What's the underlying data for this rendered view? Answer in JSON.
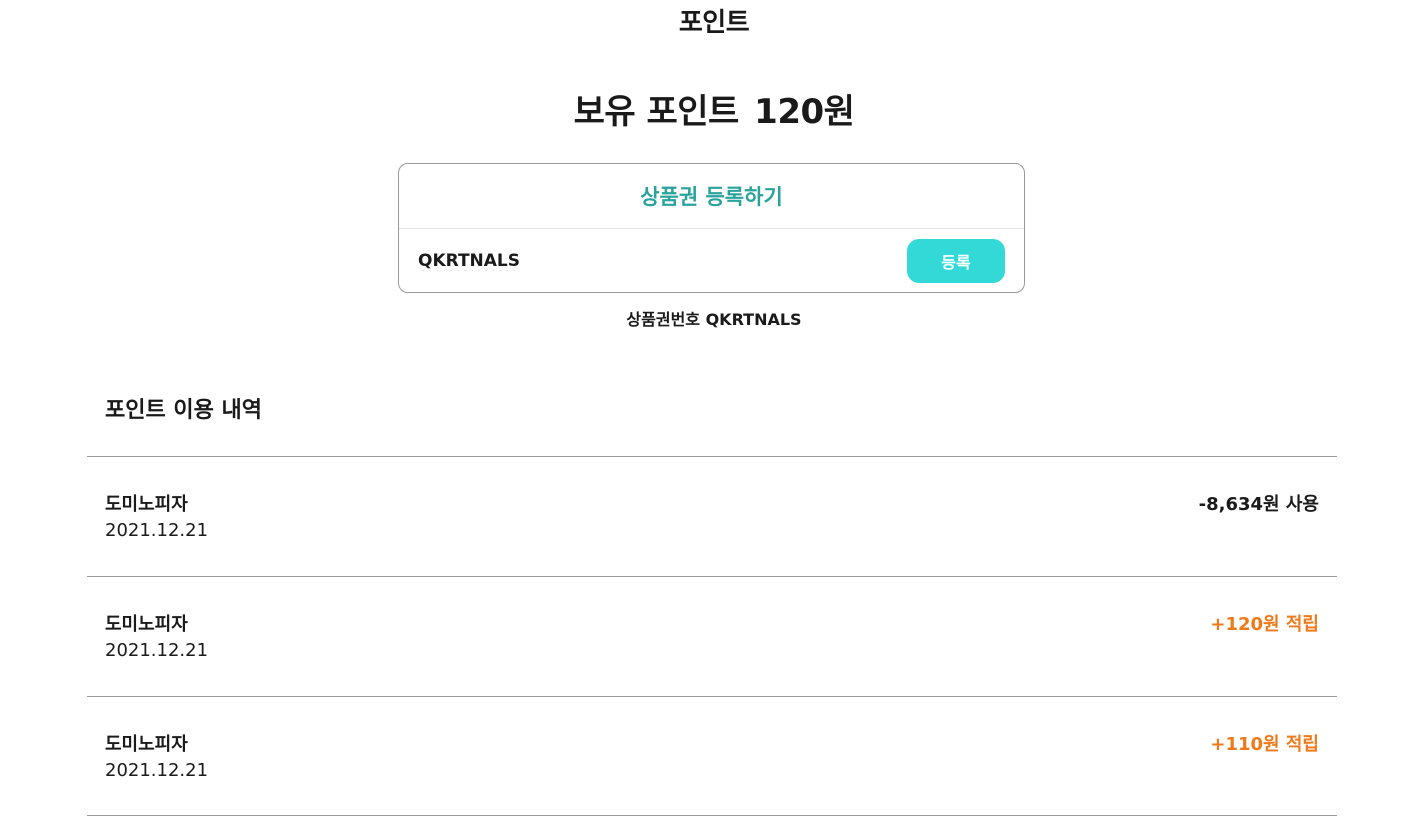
{
  "page_title": "포인트",
  "balance": {
    "label": "보유 포인트",
    "amount": "120원"
  },
  "voucher": {
    "heading": "상품권 등록하기",
    "input_value": "QKRTNALS",
    "button_label": "등록",
    "caption": "상품권번호 QKRTNALS",
    "heading_color": "#2aa39c",
    "button_color": "#33d9d6"
  },
  "history": {
    "title": "포인트 이용 내역",
    "rows": [
      {
        "store": "도미노피자",
        "date": "2021.12.21",
        "amount": "-8,634원 사용",
        "kind": "use"
      },
      {
        "store": "도미노피자",
        "date": "2021.12.21",
        "amount": "+120원 적립",
        "kind": "earn"
      },
      {
        "store": "도미노피자",
        "date": "2021.12.21",
        "amount": "+110원 적립",
        "kind": "earn"
      }
    ],
    "earn_color": "#f07a1a"
  }
}
